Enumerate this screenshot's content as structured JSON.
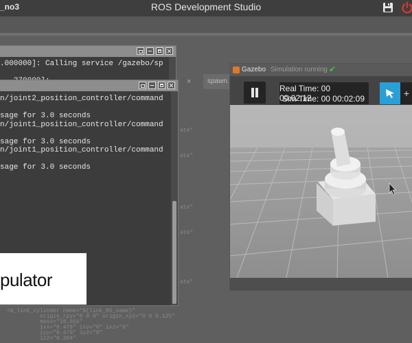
{
  "header": {
    "project_name": "_no3",
    "app_title": "ROS Development Studio",
    "save_icon": "save-icon",
    "power_icon": "power-icon",
    "power_color": "#d13b2e"
  },
  "editor": {
    "tab_label": "spawn.",
    "tab_close": "×",
    "fragments": [
      "ate\"",
      "ate\"",
      "ate\"",
      "ate\"",
      "ate\""
    ],
    "code_lines": [
      "<m_link_cylinder name=\"${link_05_name}\"",
      "origin_rpy=\"0 0 0\" origin_xyz=\"0 0 0.125\"",
      "mass=\"18.056\"",
      "ixx=\"0.479\" ixy=\"0\" ixz=\"0\"",
      "iyy=\"0.479\" iyz=\"0\"",
      "izz=\"0.204\""
    ]
  },
  "terminal_back": {
    "lines": [
      ".000000]: Calling service /gazebo/sp",
      "",
      "  .270000]: "
    ]
  },
  "terminal_front": {
    "lines": [
      "n/joint2_position_controller/command",
      "",
      "sage for 3.0 seconds",
      "n/joint1_position_controller/command",
      "",
      "sage for 3.0 seconds",
      "n/joint1_position_controller/command",
      "",
      "sage for 3.0 seconds"
    ]
  },
  "overlay": {
    "text": "pulator"
  },
  "gazebo": {
    "window_title": "Gazebo",
    "status": "Simulation running",
    "status_icon": "check-icon",
    "real_time": "Real Time: 00 00:02:12",
    "sim_time": "Sim Time: 00 00:02:09",
    "accent_color": "#2a9fd6",
    "next_label": "+"
  }
}
